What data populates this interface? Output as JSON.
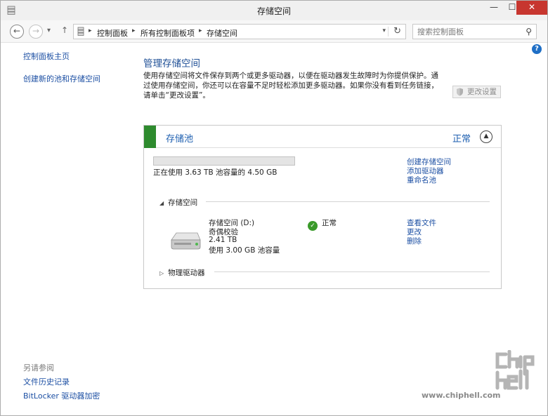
{
  "window": {
    "title": "存储空间",
    "controls": {
      "minimize": "—",
      "maximize": "☐",
      "close": "✕"
    }
  },
  "addressbar": {
    "breadcrumb": [
      "控制面板",
      "所有控制面板项",
      "存储空间"
    ],
    "search_placeholder": "搜索控制面板"
  },
  "sidebar": {
    "home_link": "控制面板主页",
    "create_link": "创建新的池和存储空间",
    "see_also_label": "另请参阅",
    "see_also_links": [
      "文件历史记录",
      "BitLocker 驱动器加密"
    ]
  },
  "main": {
    "title": "管理存储空间",
    "description": "使用存储空间将文件保存到两个或更多驱动器，以便在驱动器发生故障时为你提供保护。通过使用存储空间，你还可以在容量不足时轻松添加更多驱动器。如果你没有看到任务链接，请单击“更改设置”。",
    "change_settings_label": "更改设置"
  },
  "pool": {
    "title": "存储池",
    "status": "正常",
    "usage_text": "正在使用 3.63 TB 池容量的 4.50 GB",
    "links": [
      "创建存储空间",
      "添加驱动器",
      "重命名池"
    ],
    "storage_spaces_header": "存储空间",
    "physical_drives_header": "物理驱动器",
    "space": {
      "name": "存储空间 (D:)",
      "resiliency": "奇偶校验",
      "size": "2.41 TB",
      "pool_usage": "使用 3.00 GB 池容量",
      "status": "正常",
      "links": [
        "查看文件",
        "更改",
        "删除"
      ]
    }
  },
  "icons": {
    "app": "storage-spaces-icon",
    "back": "back-arrow-icon",
    "forward": "forward-arrow-icon",
    "up": "up-arrow-icon",
    "search": "search-icon",
    "refresh": "refresh-icon",
    "help": "help-icon",
    "shield": "shield-icon",
    "drive": "drive-icon",
    "check": "check-icon"
  },
  "colors": {
    "link": "#1c4fa3",
    "title": "#1e4f96",
    "pool_accent": "#2e8b2e",
    "close_button": "#c7362f"
  },
  "watermark": {
    "url": "www.chiphell.com"
  }
}
